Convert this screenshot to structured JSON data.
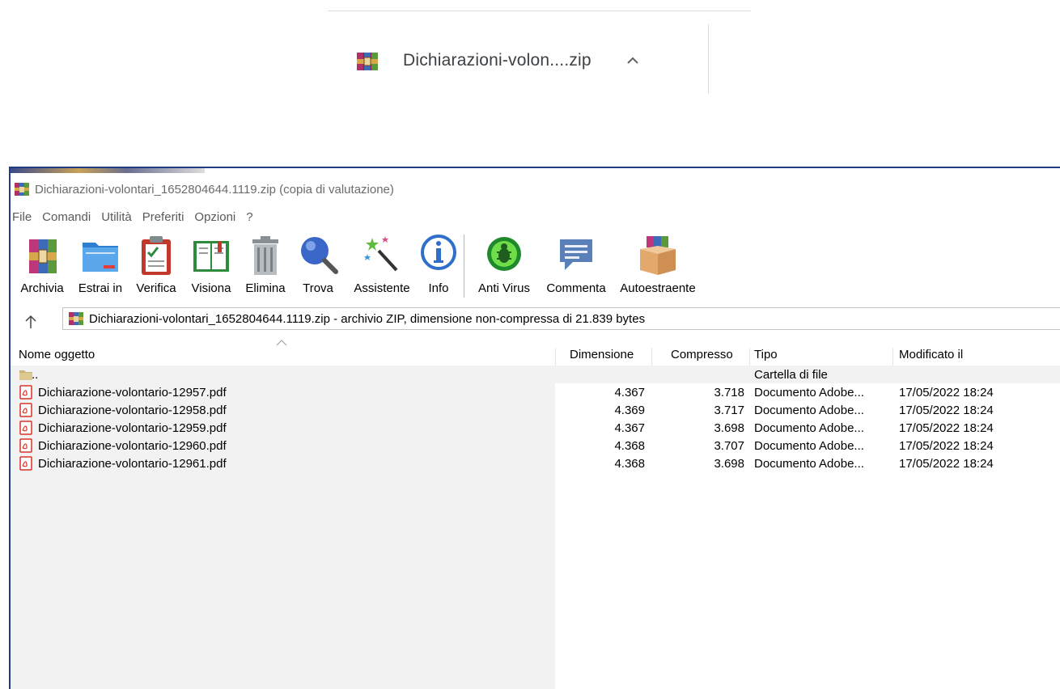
{
  "download_bar": {
    "filename": "Dichiarazioni-volon....zip"
  },
  "window": {
    "title": "Dichiarazioni-volontari_1652804644.1119.zip (copia di valutazione)",
    "menu": [
      "File",
      "Comandi",
      "Utilità",
      "Preferiti",
      "Opzioni",
      "?"
    ],
    "toolbar": [
      {
        "label": "Archivia",
        "icon": "archive-icon"
      },
      {
        "label": "Estrai in",
        "icon": "extract-folder-icon"
      },
      {
        "label": "Verifica",
        "icon": "test-clipboard-icon"
      },
      {
        "label": "Visiona",
        "icon": "view-book-icon"
      },
      {
        "label": "Elimina",
        "icon": "trash-icon"
      },
      {
        "label": "Trova",
        "icon": "magnifier-icon"
      },
      {
        "label": "Assistente",
        "icon": "wizard-wand-icon"
      },
      {
        "label": "Info",
        "icon": "info-icon"
      },
      {
        "label": "Anti Virus",
        "icon": "antivirus-bug-icon"
      },
      {
        "label": "Commenta",
        "icon": "comment-icon"
      },
      {
        "label": "Autoestraente",
        "icon": "sfx-box-icon"
      }
    ],
    "address": "Dichiarazioni-volontari_1652804644.1119.zip - archivio ZIP, dimensione non-compressa di 21.839 bytes",
    "columns": {
      "name": "Nome oggetto",
      "size": "Dimensione",
      "packed": "Compresso",
      "type": "Tipo",
      "modified": "Modificato il"
    },
    "parent_row": {
      "name": "..",
      "type": "Cartella di file"
    },
    "files": [
      {
        "name": "Dichiarazione-volontario-12957.pdf",
        "size": "4.367",
        "packed": "3.718",
        "type": "Documento Adobe...",
        "modified": "17/05/2022 18:24"
      },
      {
        "name": "Dichiarazione-volontario-12958.pdf",
        "size": "4.369",
        "packed": "3.717",
        "type": "Documento Adobe...",
        "modified": "17/05/2022 18:24"
      },
      {
        "name": "Dichiarazione-volontario-12959.pdf",
        "size": "4.367",
        "packed": "3.698",
        "type": "Documento Adobe...",
        "modified": "17/05/2022 18:24"
      },
      {
        "name": "Dichiarazione-volontario-12960.pdf",
        "size": "4.368",
        "packed": "3.707",
        "type": "Documento Adobe...",
        "modified": "17/05/2022 18:24"
      },
      {
        "name": "Dichiarazione-volontario-12961.pdf",
        "size": "4.368",
        "packed": "3.698",
        "type": "Documento Adobe...",
        "modified": "17/05/2022 18:24"
      }
    ]
  }
}
